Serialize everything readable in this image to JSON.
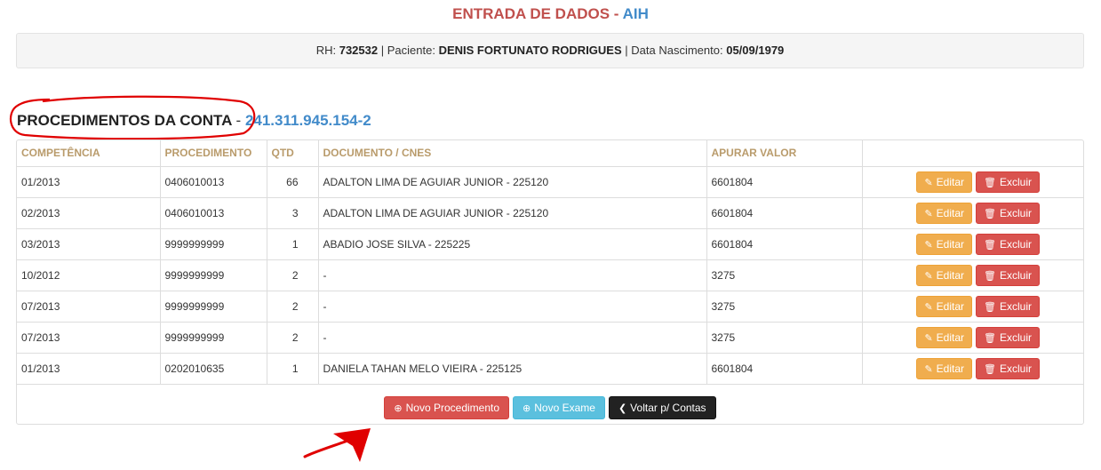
{
  "header": {
    "title_part1": "ENTRADA DE DADOS -",
    "title_part2": "AIH"
  },
  "patient": {
    "rh_label": "RH:",
    "rh_value": "732532",
    "patient_label": "| Paciente:",
    "patient_value": "DENIS FORTUNATO RODRIGUES",
    "birth_label": "| Data Nascimento:",
    "birth_value": "05/09/1979"
  },
  "section": {
    "title": "PROCEDIMENTOS DA CONTA",
    "separator": "-",
    "account_number": "241.311.945.154-2"
  },
  "table": {
    "columns": [
      "COMPETÊNCIA",
      "PROCEDIMENTO",
      "QTD",
      "DOCUMENTO / CNES",
      "APURAR VALOR",
      ""
    ],
    "rows": [
      {
        "competencia": "01/2013",
        "procedimento": "0406010013",
        "qtd": "66",
        "documento": "ADALTON LIMA DE AGUIAR JUNIOR - 225120",
        "valor": "6601804"
      },
      {
        "competencia": "02/2013",
        "procedimento": "0406010013",
        "qtd": "3",
        "documento": "ADALTON LIMA DE AGUIAR JUNIOR - 225120",
        "valor": "6601804"
      },
      {
        "competencia": "03/2013",
        "procedimento": "9999999999",
        "qtd": "1",
        "documento": "ABADIO JOSE SILVA - 225225",
        "valor": "6601804"
      },
      {
        "competencia": "10/2012",
        "procedimento": "9999999999",
        "qtd": "2",
        "documento": "-",
        "valor": "3275"
      },
      {
        "competencia": "07/2013",
        "procedimento": "9999999999",
        "qtd": "2",
        "documento": "-",
        "valor": "3275"
      },
      {
        "competencia": "07/2013",
        "procedimento": "9999999999",
        "qtd": "2",
        "documento": "-",
        "valor": "3275"
      },
      {
        "competencia": "01/2013",
        "procedimento": "0202010635",
        "qtd": "1",
        "documento": "DANIELA TAHAN MELO VIEIRA - 225125",
        "valor": "6601804"
      }
    ],
    "edit_label": "Editar",
    "delete_label": "Excluir"
  },
  "footer": {
    "new_procedure_label": "Novo Procedimento",
    "new_exam_label": "Novo Exame",
    "back_label": "Voltar p/ Contas"
  },
  "icons": {
    "edit": "pencil-icon",
    "delete": "trash-icon",
    "add": "plus-circle-icon",
    "back": "chevron-left-icon"
  },
  "colors": {
    "title_red": "#c0504d",
    "title_blue": "#428bca",
    "header_text": "#b99b6b",
    "warning": "#f0ad4e",
    "danger": "#d9534f",
    "info": "#5bc0de",
    "dark": "#222222",
    "annotation": "#e00000"
  }
}
